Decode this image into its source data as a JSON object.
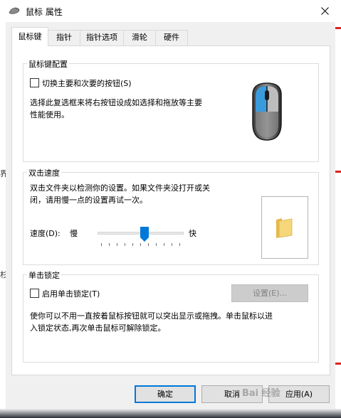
{
  "window": {
    "title": "鼠标 属性",
    "close_glyph": "✕"
  },
  "tabs": [
    {
      "label": "鼠标键"
    },
    {
      "label": "指针"
    },
    {
      "label": "指针选项"
    },
    {
      "label": "滑轮"
    },
    {
      "label": "硬件"
    }
  ],
  "button_config": {
    "group_title": "鼠标键配置",
    "switch_checkbox_label": "切换主要和次要的按钮(S)",
    "switch_checked": false,
    "desc_line1": "选择此复选框来将右按钮设成如选择和拖放等主要",
    "desc_line2": "性能使用。"
  },
  "double_click": {
    "group_title": "双击速度",
    "desc_line1": "双击文件夹以检测你的设置。如果文件夹没打开或关",
    "desc_line2": "闭，请用慢一点的设置再试一次。",
    "speed_label": "速度(D):",
    "slow_label": "慢",
    "fast_label": "快",
    "speed_fraction": 0.55
  },
  "click_lock": {
    "group_title": "单击锁定",
    "checkbox_label": "启用单击锁定(T)",
    "checked": false,
    "settings_button": "设置(E)...",
    "desc_line1": "使你可以不用一直按着鼠标按钮就可以突出显示或拖拽。单击鼠标以进",
    "desc_line2": "入锁定状态,再次单击鼠标可解除锁定。"
  },
  "footer": {
    "ok": "确定",
    "cancel": "取消",
    "apply": "应用(A)"
  },
  "background": {
    "glyph_left_1": "界",
    "glyph_left_2": "杉"
  },
  "watermark": "Bai 经验",
  "colors": {
    "accent": "#0078d7",
    "mouse_highlight": "#3a9bdc",
    "folder": "#f5d77a"
  }
}
